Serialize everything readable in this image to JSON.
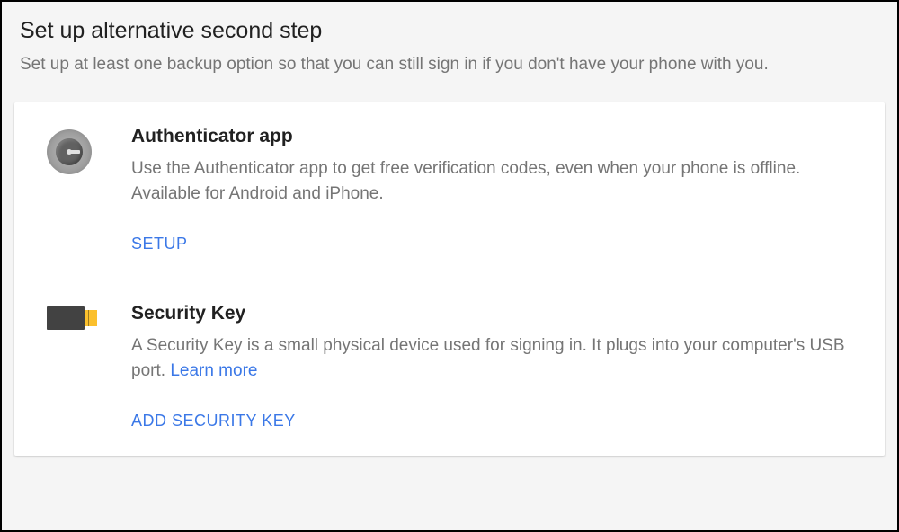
{
  "header": {
    "title": "Set up alternative second step",
    "subtitle": "Set up at least one backup option so that you can still sign in if you don't have your phone with you."
  },
  "options": {
    "authenticator": {
      "title": "Authenticator app",
      "description": "Use the Authenticator app to get free verification codes, even when your phone is offline. Available for Android and iPhone.",
      "action": "SETUP"
    },
    "security_key": {
      "title": "Security Key",
      "description_pre": "A Security Key is a small physical device used for signing in. It plugs into your computer's USB port. ",
      "learn_more": "Learn more",
      "action": "ADD SECURITY KEY"
    }
  }
}
